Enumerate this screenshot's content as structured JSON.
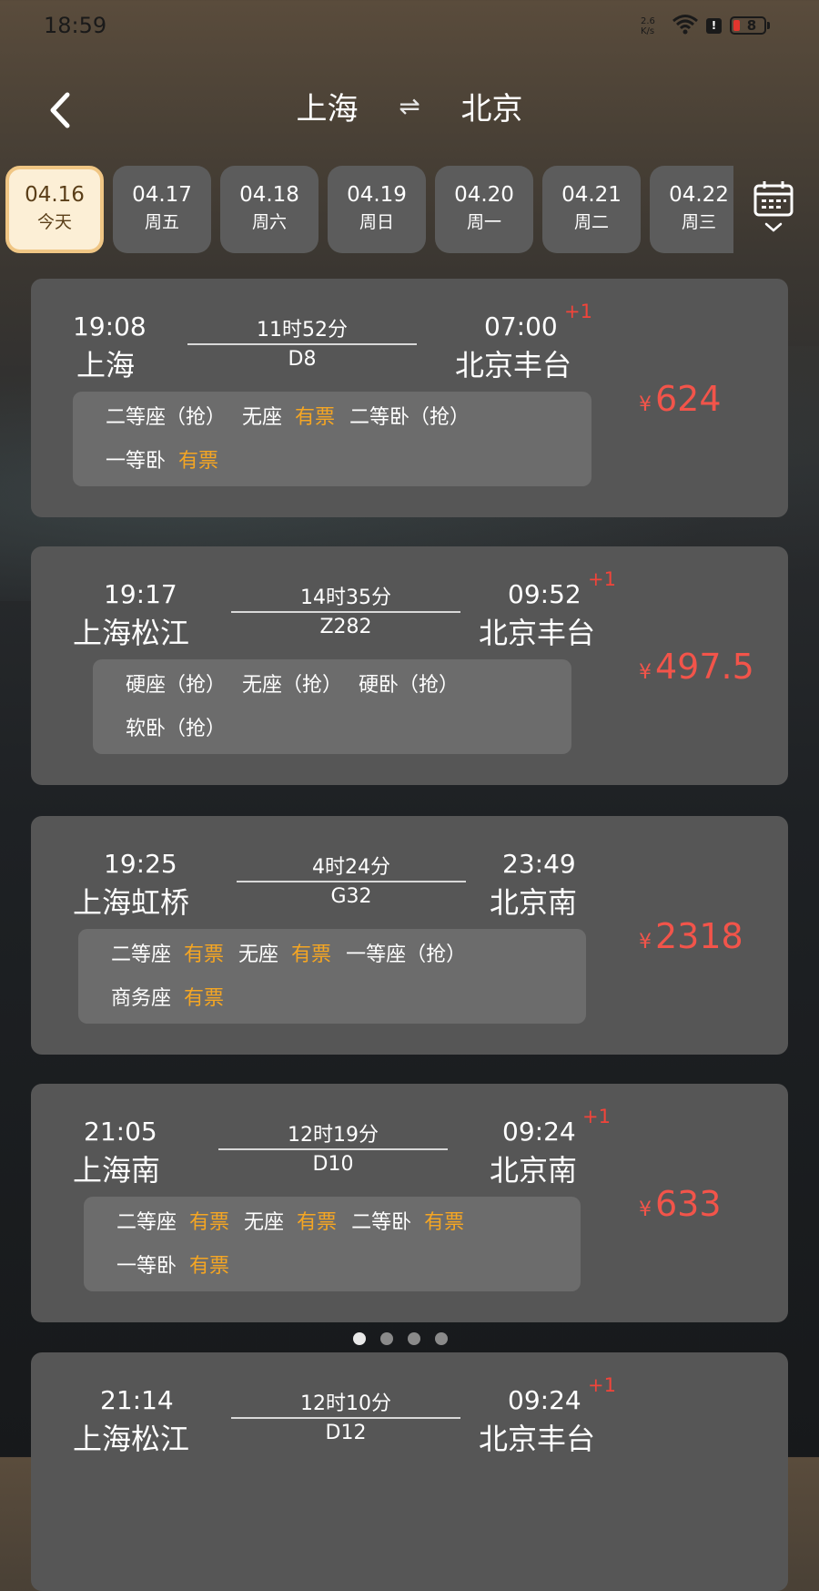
{
  "status_bar": {
    "time": "18:59",
    "net_speed_top": "2.6",
    "net_speed_unit": "K/s",
    "battery_level": "8"
  },
  "header": {
    "from": "上海",
    "to": "北京",
    "swap_glyph": "⇌"
  },
  "date_tabs": [
    {
      "date": "04.16",
      "weekday": "今天",
      "active": true
    },
    {
      "date": "04.17",
      "weekday": "周五"
    },
    {
      "date": "04.18",
      "weekday": "周六"
    },
    {
      "date": "04.19",
      "weekday": "周日"
    },
    {
      "date": "04.20",
      "weekday": "周一"
    },
    {
      "date": "04.21",
      "weekday": "周二"
    },
    {
      "date": "04.22",
      "weekday": "周三"
    }
  ],
  "trains": [
    {
      "depart_time": "19:08",
      "depart_station": "上海",
      "arrive_time": "07:00",
      "arrive_station": "北京丰台",
      "next_day": "+1",
      "duration": "11时52分",
      "train_no": "D8",
      "yen": "¥",
      "price": "624",
      "seat_rows": [
        [
          {
            "name": "二等座（抢）"
          },
          {
            "name": "无座",
            "avail": "有票"
          },
          {
            "name": "二等卧（抢）"
          }
        ],
        [
          {
            "name": "一等卧",
            "avail": "有票"
          }
        ]
      ]
    },
    {
      "depart_time": "19:17",
      "depart_station": "上海松江",
      "arrive_time": "09:52",
      "arrive_station": "北京丰台",
      "next_day": "+1",
      "duration": "14时35分",
      "train_no": "Z282",
      "yen": "¥",
      "price": "497.5",
      "seat_rows": [
        [
          {
            "name": "硬座（抢）"
          },
          {
            "name": "无座（抢）"
          },
          {
            "name": "硬卧（抢）"
          }
        ],
        [
          {
            "name": "软卧（抢）"
          }
        ]
      ]
    },
    {
      "depart_time": "19:25",
      "depart_station": "上海虹桥",
      "arrive_time": "23:49",
      "arrive_station": "北京南",
      "next_day": "",
      "duration": "4时24分",
      "train_no": "G32",
      "yen": "¥",
      "price": "2318",
      "seat_rows": [
        [
          {
            "name": "二等座",
            "avail": "有票"
          },
          {
            "name": "无座",
            "avail": "有票"
          },
          {
            "name": "一等座（抢）"
          }
        ],
        [
          {
            "name": "商务座",
            "avail": "有票"
          }
        ]
      ]
    },
    {
      "depart_time": "21:05",
      "depart_station": "上海南",
      "arrive_time": "09:24",
      "arrive_station": "北京南",
      "next_day": "+1",
      "duration": "12时19分",
      "train_no": "D10",
      "yen": "¥",
      "price": "633",
      "seat_rows": [
        [
          {
            "name": "二等座",
            "avail": "有票"
          },
          {
            "name": "无座",
            "avail": "有票"
          },
          {
            "name": "二等卧",
            "avail": "有票"
          }
        ],
        [
          {
            "name": "一等卧",
            "avail": "有票"
          }
        ]
      ]
    },
    {
      "depart_time": "21:14",
      "depart_station": "上海松江",
      "arrive_time": "09:24",
      "arrive_station": "北京丰台",
      "next_day": "+1",
      "duration": "12时10分",
      "train_no": "D12",
      "yen": "¥",
      "price": "",
      "seat_rows": []
    }
  ],
  "pager": {
    "count": 4,
    "active": 0
  },
  "icons": {
    "back": "back-arrow-icon",
    "swap": "swap-icon",
    "calendar": "calendar-icon"
  },
  "colors": {
    "price": "#f2544a",
    "available": "#f5a623",
    "active_tab_bg": "#fcefd6",
    "active_tab_border": "#f0c684"
  }
}
